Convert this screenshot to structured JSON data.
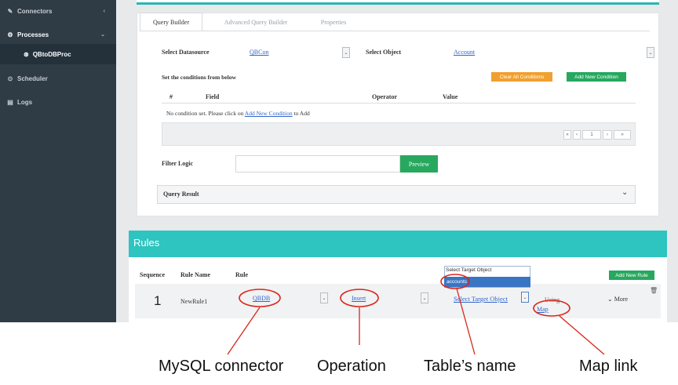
{
  "sidebar": {
    "items": [
      {
        "label": "Connectors",
        "icon": "plug-icon"
      },
      {
        "label": "Processes",
        "icon": "gears-icon"
      },
      {
        "label": "Scheduler",
        "icon": "clock-icon"
      },
      {
        "label": "Logs",
        "icon": "document-icon"
      }
    ],
    "sub_item": {
      "label": "QBtoDBProc",
      "icon": "circle-arrow-icon"
    }
  },
  "tabs": [
    "Query Builder",
    "Advanced Query Builder",
    "Properties"
  ],
  "query": {
    "datasource_label": "Select Datasource",
    "datasource_value": "QBCon",
    "object_label": "Select Object",
    "object_value": "Account",
    "conditions_label": "Set the conditions from below",
    "clear_btn": "Clear All Conditions",
    "add_btn": "Add New Condition",
    "columns": [
      "#",
      "Field",
      "Operator",
      "Value"
    ],
    "empty_prefix": "No condition set. Please click on ",
    "empty_link": "Add New Condition",
    "empty_suffix": " to Add",
    "pager": [
      "«",
      "‹",
      "1",
      "›",
      "»"
    ],
    "filter_label": "Filter Logic",
    "preview_btn": "Preview",
    "result_label": "Query Result"
  },
  "rules": {
    "title": "Rules",
    "columns": [
      "Sequence",
      "Rule Name",
      "Rule"
    ],
    "add_btn": "Add New Rule",
    "row": {
      "sequence": "1",
      "name": "NewRule1",
      "connector": "QBDB",
      "operation": "Insert",
      "target": "Select Target Object",
      "using": "Using",
      "map": "Map",
      "more": "More"
    },
    "dropdown_options": [
      "Select Target Object",
      "accounts"
    ]
  },
  "annotations": [
    "MySQL connector",
    "Operation",
    "Table’s name",
    "Map link"
  ],
  "colors": {
    "sidebar": "#2f3b45",
    "teal": "#2ec4c0",
    "green": "#27a85e",
    "orange": "#f0a030",
    "annotation_red": "#d9261c"
  }
}
